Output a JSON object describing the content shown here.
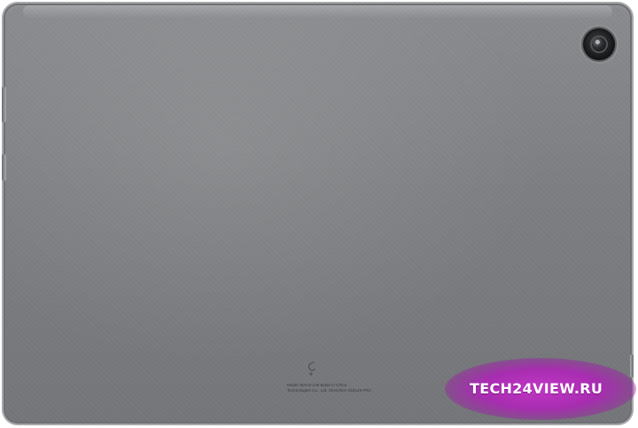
{
  "image": {
    "subject": "tablet-back-panel",
    "body_color": "#7e7f82",
    "frame_color": "#a9aaad"
  },
  "regulatory": {
    "model_line": "Model: BAH2-L09   Made in China",
    "maker_line": "Technologies Co., Ltd. Shenzhen 518129 PRC"
  },
  "watermark": {
    "text": "TECH24VIEW.RU",
    "color": "#b832be"
  }
}
